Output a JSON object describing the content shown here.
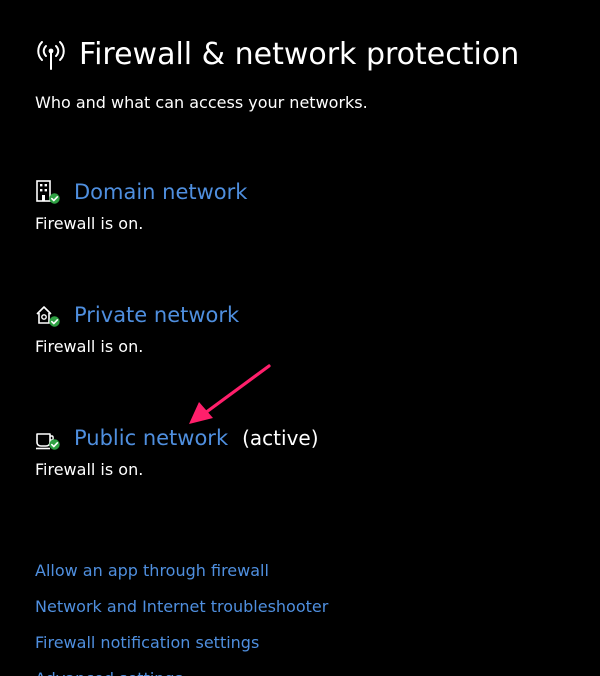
{
  "header": {
    "title": "Firewall & network protection",
    "subtitle": "Who and what can access your networks.",
    "icon": "wifi-signal-icon"
  },
  "networks": [
    {
      "label": "Domain network",
      "status": "Firewall is on.",
      "active_label": "",
      "icon": "building-icon"
    },
    {
      "label": "Private network",
      "status": "Firewall is on.",
      "active_label": "",
      "icon": "home-network-icon"
    },
    {
      "label": "Public network",
      "status": "Firewall is on.",
      "active_label": "(active)",
      "icon": "coffee-cup-icon"
    }
  ],
  "links": [
    "Allow an app through firewall",
    "Network and Internet troubleshooter",
    "Firewall notification settings",
    "Advanced settings"
  ],
  "colors": {
    "background": "#000000",
    "text": "#ffffff",
    "link": "#4f8fdf",
    "status_ok": "#2ea043",
    "annotation_arrow": "#ff1f6b"
  }
}
